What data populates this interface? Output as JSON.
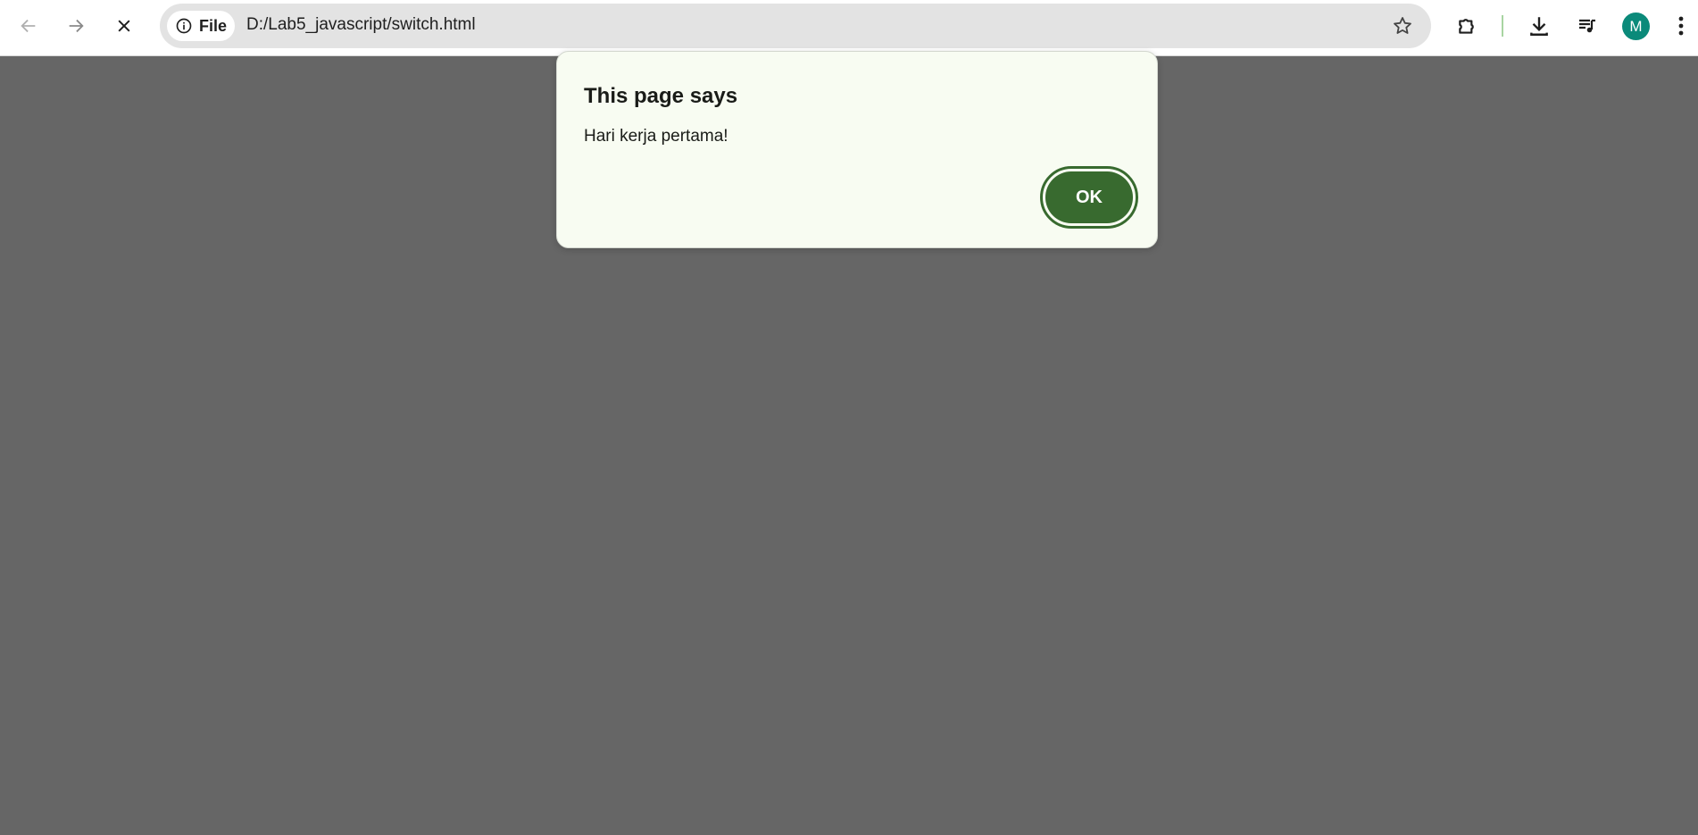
{
  "browser": {
    "address_chip_label": "File",
    "url": "D:/Lab5_javascript/switch.html",
    "profile_initial": "M",
    "icons": {
      "back": "arrow-left-icon",
      "forward": "arrow-right-icon",
      "stop": "close-icon",
      "site_info": "info-icon",
      "bookmark": "star-icon",
      "extensions": "puzzle-icon",
      "downloads": "download-icon",
      "media": "queue-music-icon",
      "menu": "kebab-menu-icon"
    },
    "colors": {
      "toolbar": "#ffffff",
      "omnibox": "#e3e3e3",
      "avatar": "#0b8a7a"
    }
  },
  "page": {
    "background_color": "#666666"
  },
  "dialog": {
    "title": "This page says",
    "message": "Hari kerja pertama!",
    "ok_label": "OK",
    "colors": {
      "background": "#f8fcf2",
      "button": "#386a2f"
    }
  }
}
